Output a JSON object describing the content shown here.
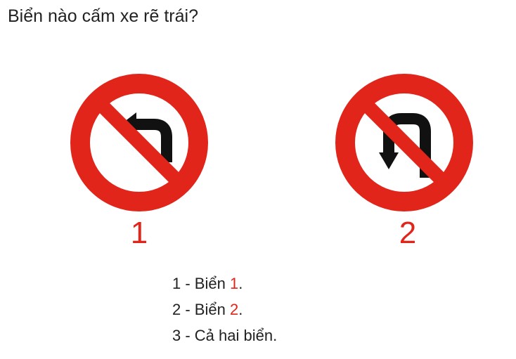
{
  "question": "Biển nào cấm xe rẽ trái?",
  "signs": [
    {
      "number": "1",
      "icon": "no-left-turn-sign-icon"
    },
    {
      "number": "2",
      "icon": "no-u-turn-sign-icon"
    }
  ],
  "answers": [
    {
      "prefix": "1 - Biển ",
      "highlight": "1",
      "suffix": "."
    },
    {
      "prefix": "2 - Biển ",
      "highlight": "2",
      "suffix": "."
    },
    {
      "prefix": "3 - Cả hai biển.",
      "highlight": "",
      "suffix": ""
    }
  ],
  "colors": {
    "sign_red": "#e1251b",
    "arrow": "#111111",
    "text": "#222222",
    "accent": "#e1251b"
  }
}
